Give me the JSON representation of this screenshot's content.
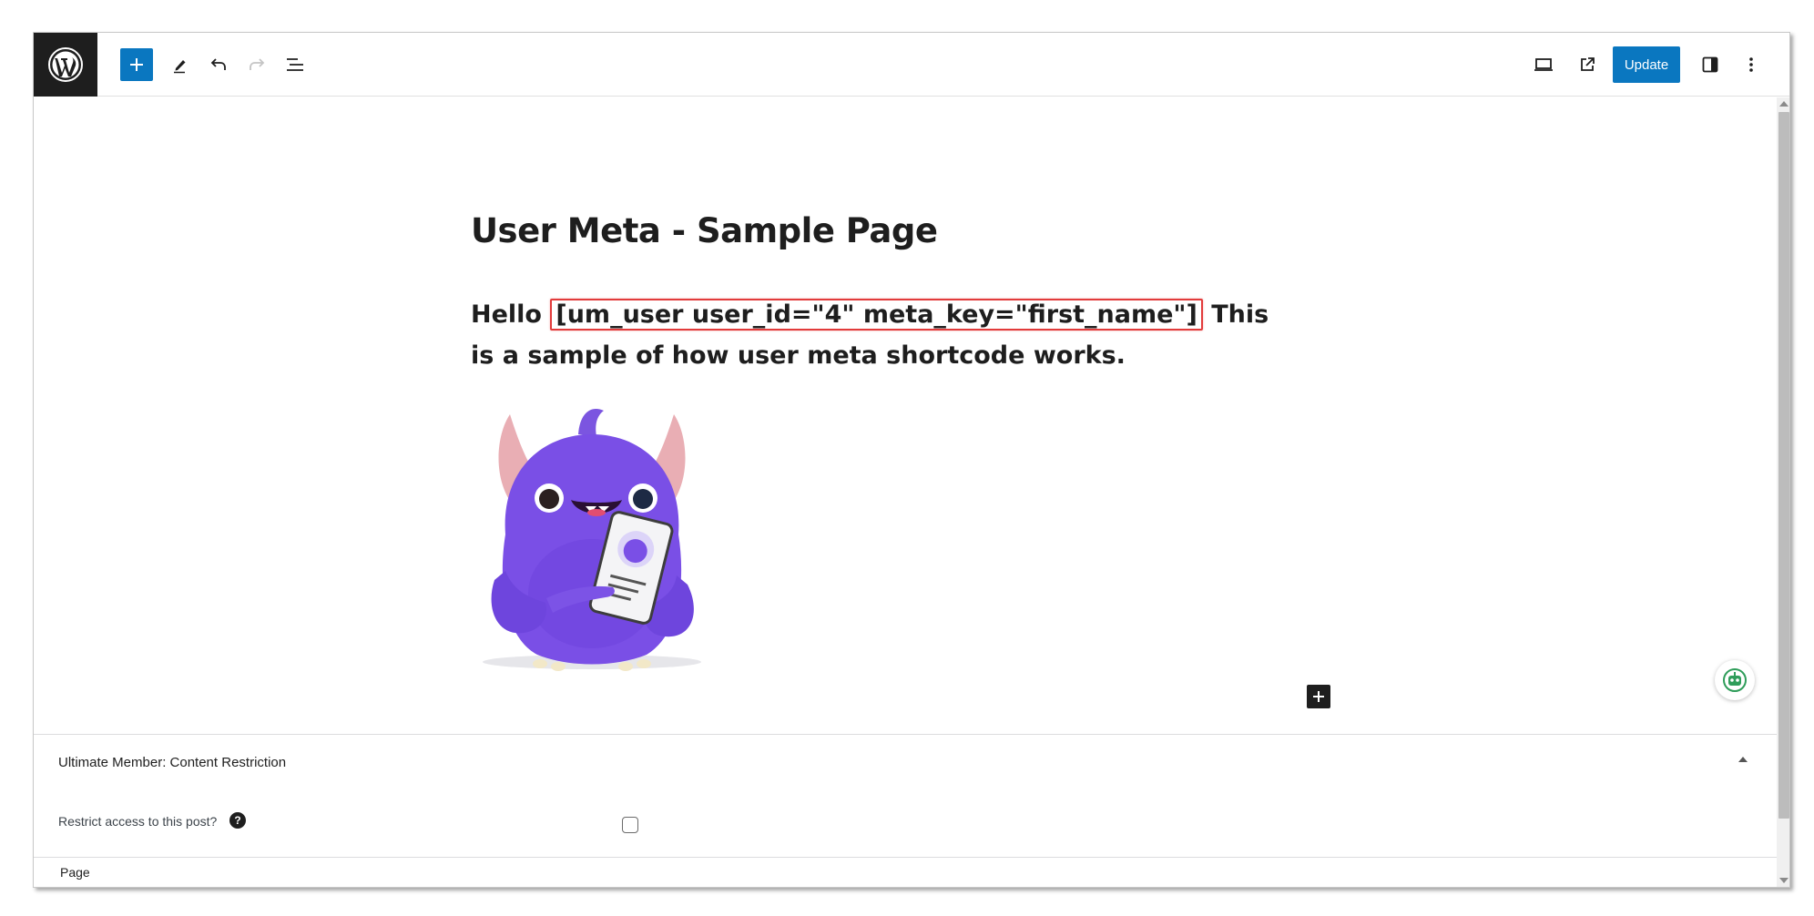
{
  "toolbar": {
    "logo_icon": "wordpress-logo-icon",
    "add_icon": "plus-icon",
    "tools_icon": "pencil-icon",
    "undo_icon": "undo-icon",
    "redo_icon": "redo-icon",
    "document_overview_icon": "list-view-icon",
    "preview_icon": "desktop-icon",
    "view_icon": "external-link-icon",
    "update_label": "Update",
    "settings_icon": "sidebar-icon",
    "options_icon": "more-vertical-icon"
  },
  "editor": {
    "title": "User Meta - Sample Page",
    "paragraph": {
      "before": "Hello ",
      "shortcode": "[um_user user_id=\"4\" meta_key=\"first_name\"]",
      "after": " This is a sample of how user meta shortcode works."
    },
    "image_icon": "purple-monster-mascot-image",
    "inserter_icon": "plus-icon",
    "assistant_icon": "robot-icon"
  },
  "metabox": {
    "title": "Ultimate Member: Content Restriction",
    "restrict_label": "Restrict access to this post?",
    "help_glyph": "?",
    "restrict_checked": false
  },
  "footer": {
    "breadcrumb": "Page"
  },
  "colors": {
    "accent": "#0a77c0",
    "shortcode_border": "#e23b3b",
    "logo_bg": "#1e1e1e"
  }
}
